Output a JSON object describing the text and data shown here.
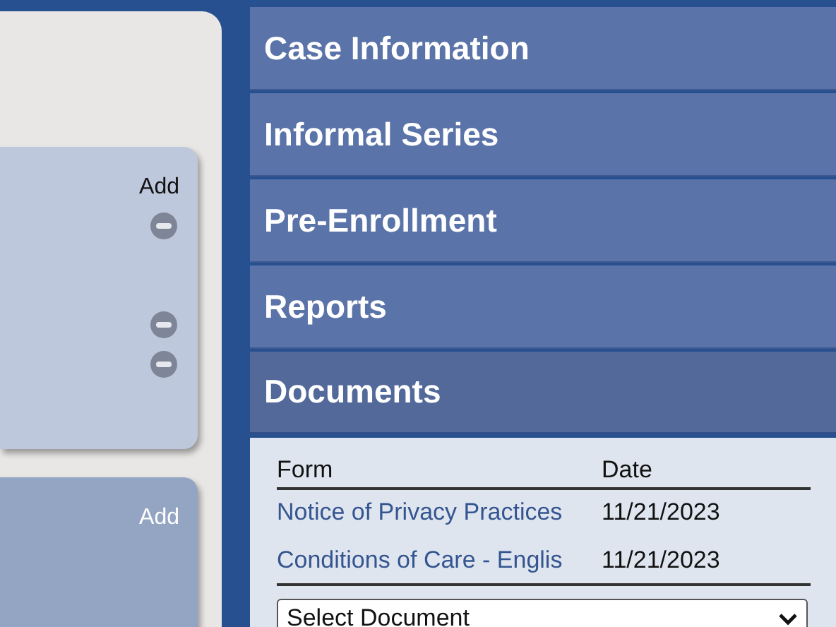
{
  "left_panel": {
    "cards": [
      {
        "add_label": "Add",
        "marks": [
          {
            "kind": "remove"
          },
          {
            "kind": "gap"
          },
          {
            "kind": "remove"
          },
          {
            "kind": "remove"
          }
        ],
        "color": "#bec8dc"
      },
      {
        "add_label": "Add",
        "color": "#94a5c3"
      }
    ]
  },
  "accordion": [
    {
      "title": "Case Information",
      "expanded": false
    },
    {
      "title": "Informal Series",
      "expanded": false
    },
    {
      "title": "Pre-Enrollment",
      "expanded": false
    },
    {
      "title": "Reports",
      "expanded": false
    },
    {
      "title": "Documents",
      "expanded": true
    }
  ],
  "documents": {
    "columns": [
      "Form",
      "Date"
    ],
    "rows": [
      {
        "form": "Notice of Privacy Practices",
        "date": "11/21/2023"
      },
      {
        "form": "Conditions of Care - Englis",
        "date": "11/21/2023"
      }
    ],
    "select": {
      "value": "Select Document"
    }
  }
}
